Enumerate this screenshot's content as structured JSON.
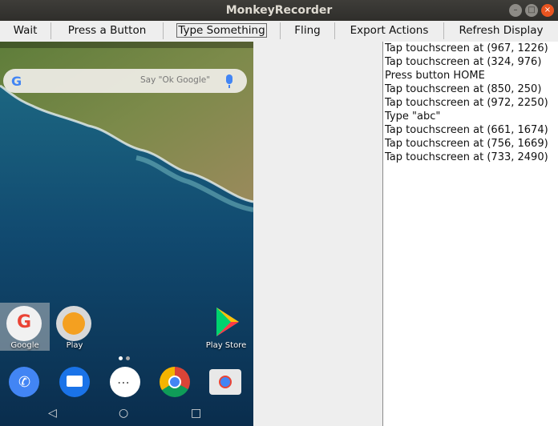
{
  "window": {
    "title": "MonkeyRecorder"
  },
  "toolbar": {
    "wait": "Wait",
    "press": "Press a Button",
    "type": "Type Something",
    "fling": "Fling",
    "export": "Export Actions",
    "refresh": "Refresh Display"
  },
  "device": {
    "search_hint": "Say \"Ok Google\"",
    "apps": {
      "google": "Google",
      "play": "Play",
      "play_store": "Play Store"
    }
  },
  "log": [
    "Tap touchscreen at (967, 1226)",
    "Tap touchscreen at (324, 976)",
    "Press button HOME",
    "Tap touchscreen at (850, 250)",
    "Tap touchscreen at (972, 2250)",
    "Type \"abc\"",
    "Tap touchscreen at (661, 1674)",
    "Tap touchscreen at (756, 1669)",
    "Tap touchscreen at (733, 2490)"
  ]
}
